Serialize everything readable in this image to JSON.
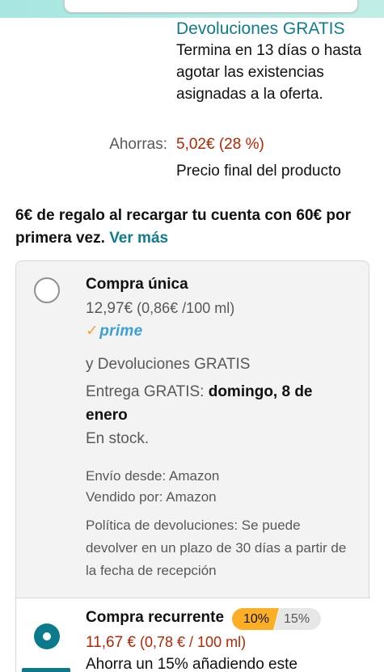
{
  "deal": {
    "returns_link": "Devoluciones GRATIS",
    "ends_text": "Termina en 13 días o hasta agotar las existencias asignadas a la oferta."
  },
  "savings": {
    "label": "Ahorras:",
    "value": "5,02€ (28 %)",
    "final_price_note": "Precio final del producto"
  },
  "promo": {
    "text": "6€ de regalo al recargar tu cuenta con 60€ por primera vez.",
    "link": "Ver más"
  },
  "one_time": {
    "title": "Compra única",
    "price": "12,97€",
    "unit_price": "(0,86€ /100 ml)",
    "prime_label": "prime",
    "returns": "y Devoluciones GRATIS",
    "delivery_prefix": "Entrega GRATIS:",
    "delivery_date": "domingo, 8 de enero",
    "stock": "En stock.",
    "ships_from": "Envío desde: Amazon",
    "sold_by": "Vendido por: Amazon",
    "return_policy": "Política de devoluciones: Se puede devolver en un plazo de 30 días a partir de la fecha de recepción"
  },
  "recurring": {
    "title": "Compra recurrente",
    "discount_1": "10%",
    "discount_2": "15%",
    "price": "11,67 €",
    "unit_price": "(0,78 € / 100 ml)",
    "savings_text": "Ahorra un 15% añadiendo este"
  },
  "colors": {
    "link": "#0f7b8c",
    "price_red": "#b12704",
    "prime_blue": "#3ba0d6",
    "badge_orange": "#fcae25",
    "radio_selected": "#0b7b8c"
  }
}
